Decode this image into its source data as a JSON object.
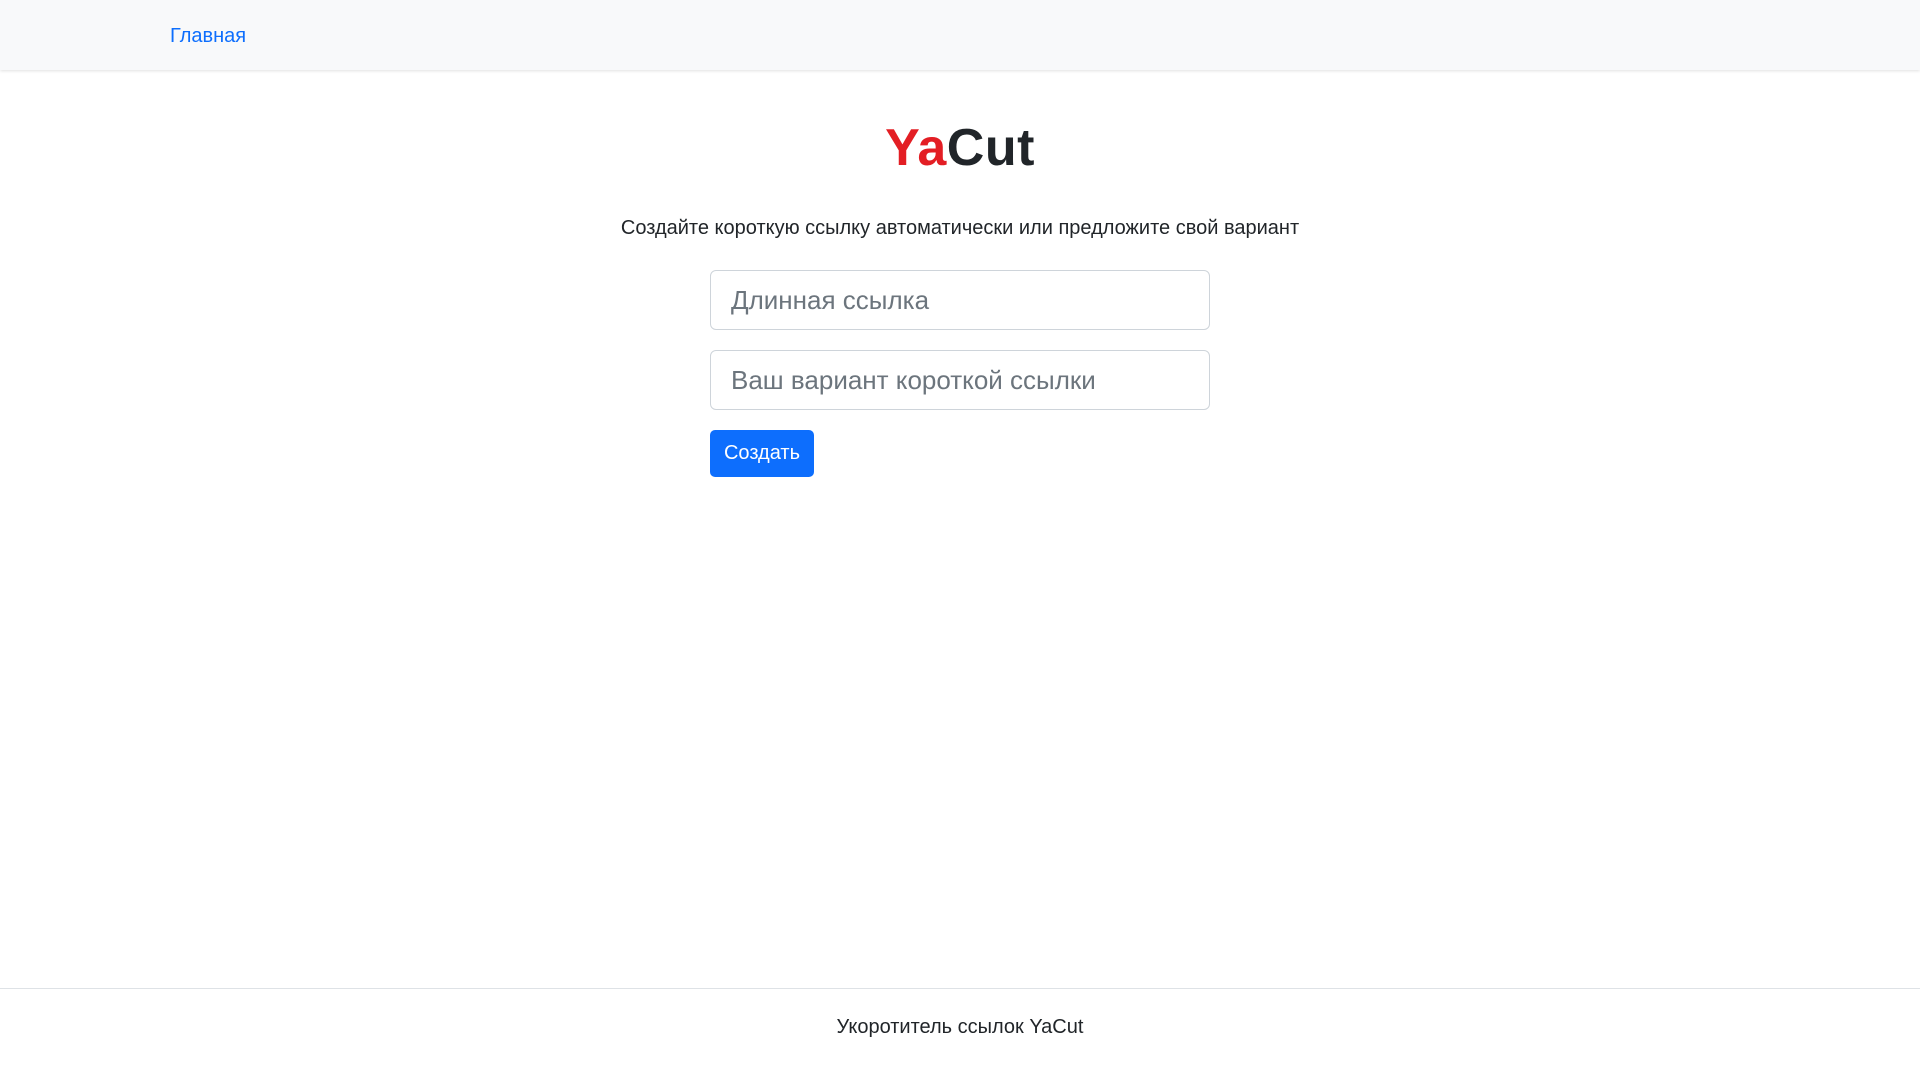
{
  "navbar": {
    "home_link": "Главная"
  },
  "brand": {
    "part1": "Ya",
    "part2": "Cut",
    "accent_color": "#e31e24"
  },
  "main": {
    "subtitle": "Создайте короткую ссылку автоматически или предложите свой вариант",
    "form": {
      "long_url_placeholder": "Длинная ссылка",
      "long_url_value": "",
      "custom_id_placeholder": "Ваш вариант короткой ссылки",
      "custom_id_value": "",
      "submit_label": "Создать",
      "submit_color": "#0d6efd"
    }
  },
  "footer": {
    "text": "Укоротитель ссылок YaCut"
  }
}
